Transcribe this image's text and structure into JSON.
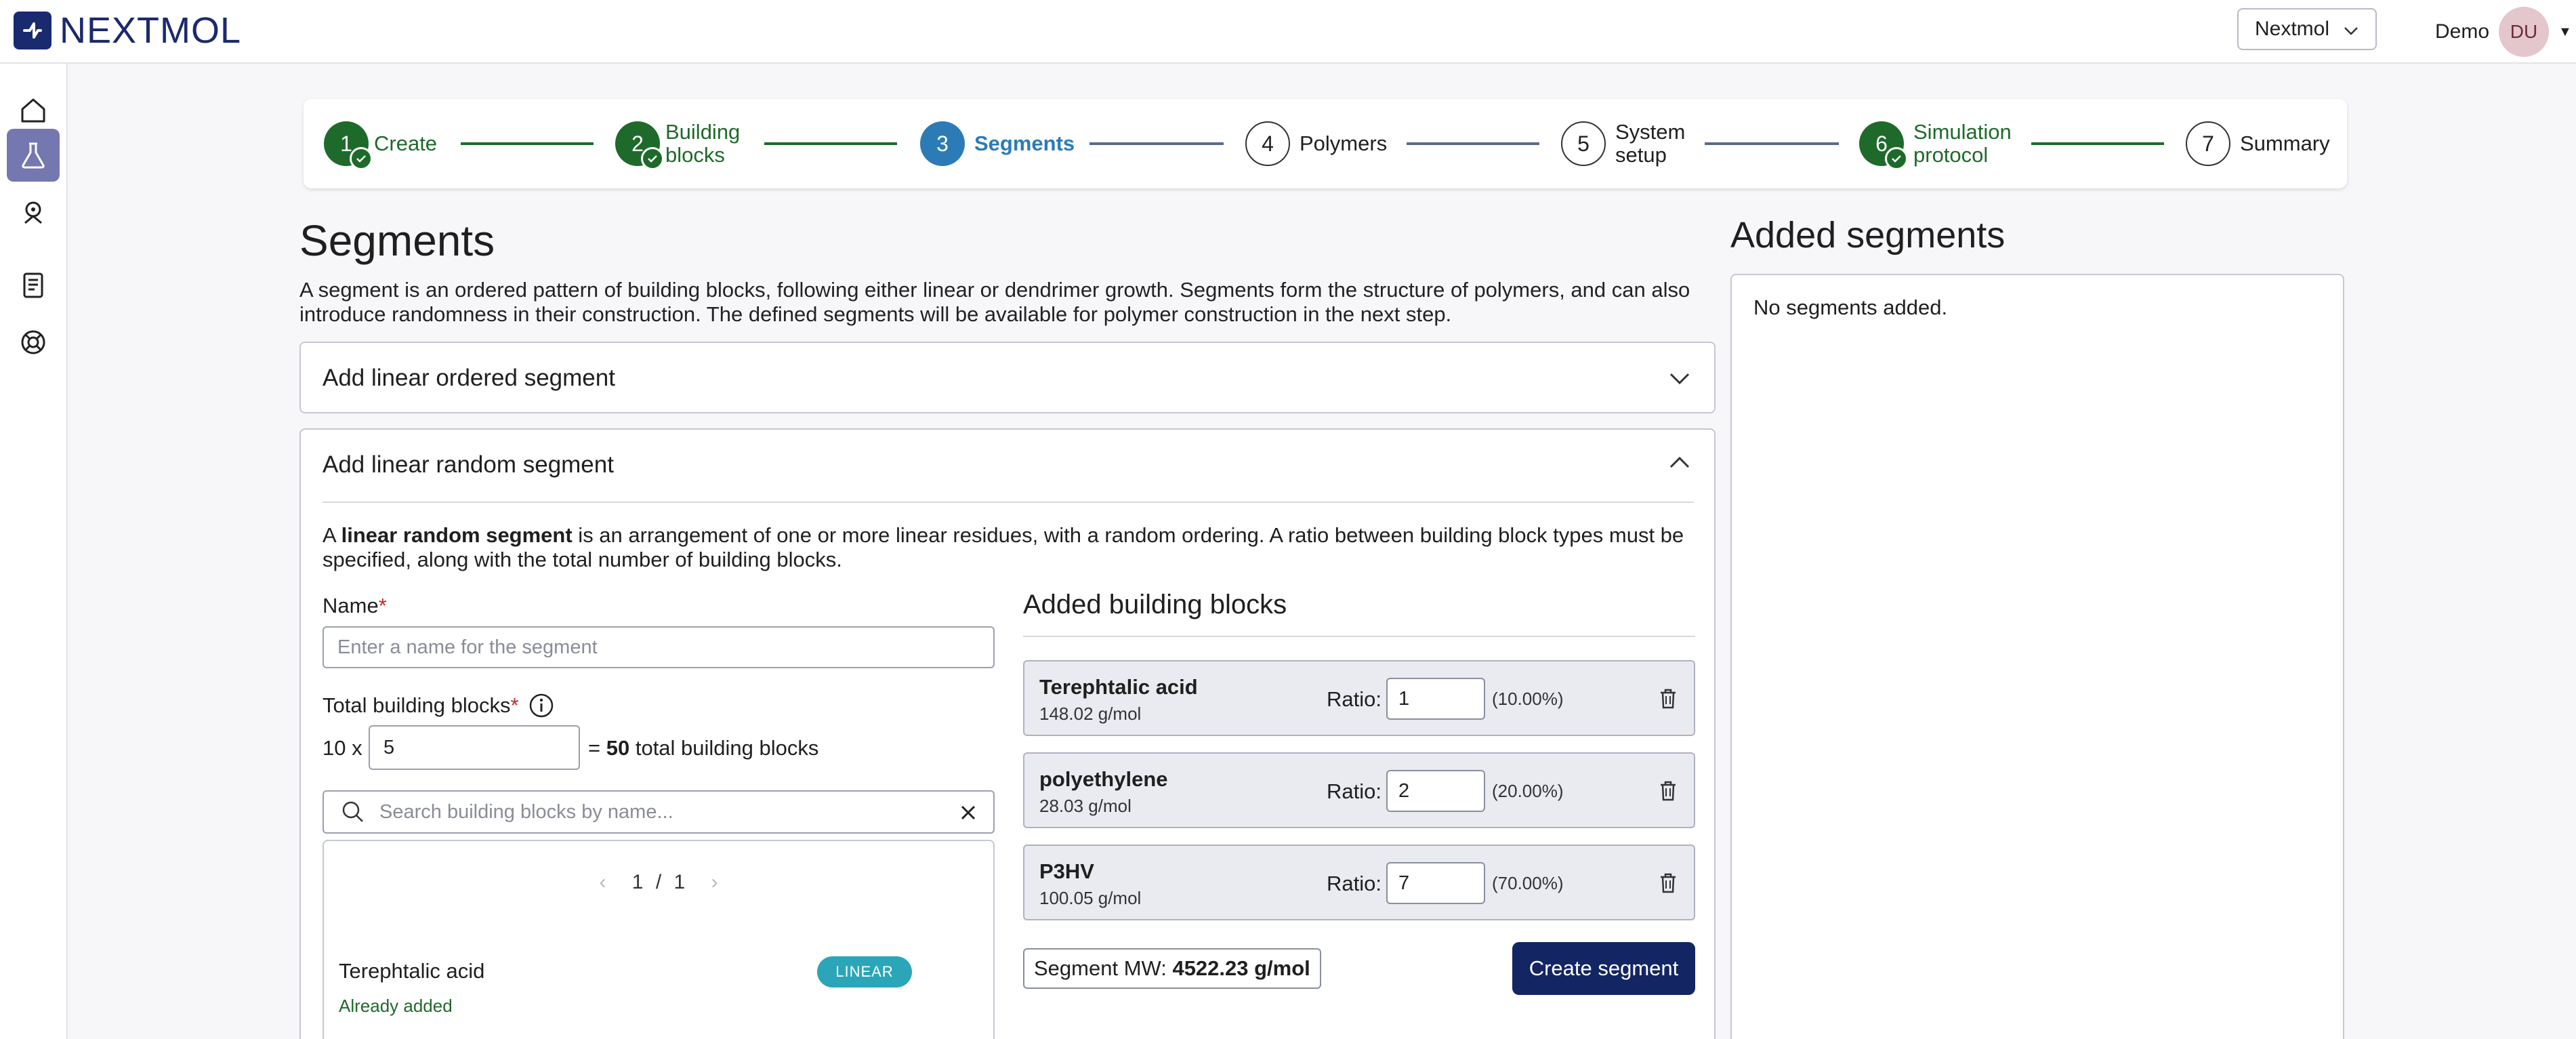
{
  "brand": {
    "name": "NEXTMOL"
  },
  "header": {
    "org_select": "Nextmol",
    "user_name": "Demo",
    "user_initials": "DU"
  },
  "sidenav": {
    "items": [
      {
        "icon": "home-icon"
      },
      {
        "icon": "flask-icon",
        "active": true
      },
      {
        "icon": "molecule-icon"
      },
      {
        "icon": "docs-icon"
      },
      {
        "icon": "support-icon"
      }
    ]
  },
  "stepper": {
    "steps": [
      {
        "num": "1",
        "label": "Create",
        "state": "done"
      },
      {
        "num": "2",
        "label_l1": "Building",
        "label_l2": "blocks",
        "state": "done"
      },
      {
        "num": "3",
        "label": "Segments",
        "state": "current"
      },
      {
        "num": "4",
        "label": "Polymers",
        "state": "todo"
      },
      {
        "num": "5",
        "label_l1": "System",
        "label_l2": "setup",
        "state": "todo"
      },
      {
        "num": "6",
        "label_l1": "Simulation",
        "label_l2": "protocol",
        "state": "done"
      },
      {
        "num": "7",
        "label": "Summary",
        "state": "todo"
      }
    ]
  },
  "main": {
    "title": "Segments",
    "description": "A segment is an ordered pattern of building blocks, following either linear or dendrimer growth. Segments form the structure of polymers, and can also introduce randomness in their construction. The defined segments will be available for polymer construction in the next step.",
    "accordion_ordered": "Add linear ordered segment",
    "accordion_random": "Add linear random segment",
    "random_desc_prefix": "A ",
    "random_desc_bold": "linear random segment",
    "random_desc_rest": " is an arrangement of one or more linear residues, with a random ordering. A ratio between building block types must be specified, along with the total number of building blocks.",
    "name_label": "Name",
    "name_placeholder": "Enter a name for the segment",
    "total_label": "Total building blocks",
    "multiplier": "10 x",
    "total_value": "5",
    "equals": "=",
    "total_result": "50",
    "total_suffix": "total building blocks",
    "search_placeholder": "Search building blocks by name...",
    "pager": {
      "current": "1",
      "sep": "/",
      "total": "1"
    },
    "list_item": {
      "name": "Terephtalic acid",
      "status": "Already added",
      "badge": "LINEAR"
    },
    "added_title": "Added building blocks",
    "blocks": [
      {
        "name": "Terephtalic acid",
        "mw": "148.02 g/mol",
        "ratio_label": "Ratio:",
        "ratio": "1",
        "pct": "(10.00%)"
      },
      {
        "name": "polyethylene",
        "mw": "28.03 g/mol",
        "ratio_label": "Ratio:",
        "ratio": "2",
        "pct": "(20.00%)"
      },
      {
        "name": "P3HV",
        "mw": "100.05 g/mol",
        "ratio_label": "Ratio:",
        "ratio": "7",
        "pct": "(70.00%)"
      }
    ],
    "segment_mw_label": "Segment MW:",
    "segment_mw_value": "4522.23 g/mol",
    "create_button": "Create segment"
  },
  "side": {
    "title": "Added segments",
    "empty": "No segments added."
  },
  "colors": {
    "primary": "#142564",
    "success": "#1e6a2a",
    "current": "#2c7bb6",
    "badge": "#2aa6b8"
  }
}
